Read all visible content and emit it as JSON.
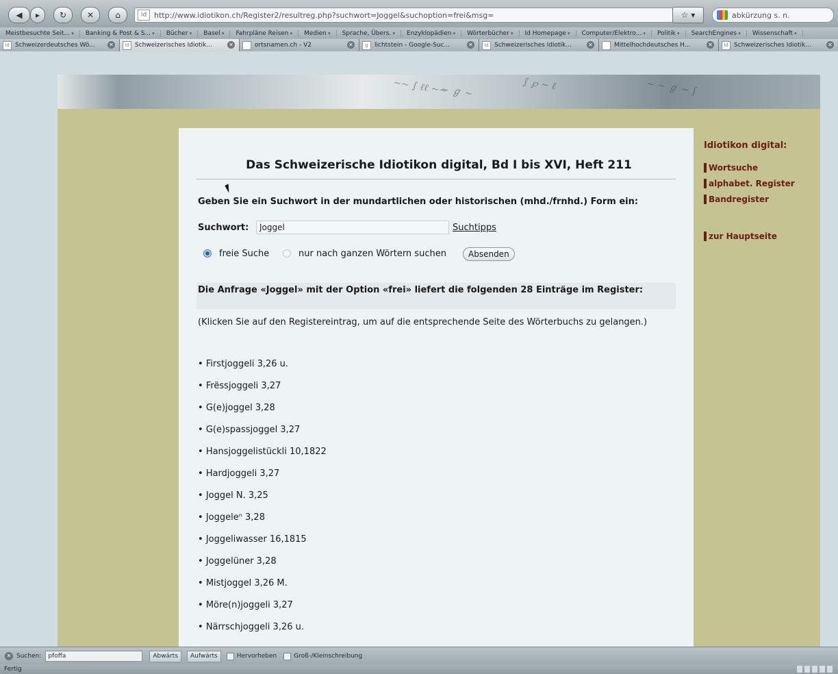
{
  "browser": {
    "back_icon": "back-arrow-icon",
    "url": "http://www.idiotikon.ch/Register2/resultreg.php?suchwort=Joggel&suchoption=frei&msg=",
    "url_favicon_text": "Id",
    "search_engine_text": "abkürzung s. n.",
    "bookmarks": [
      "Meistbesuchte Seit...",
      "Banking & Post & S...",
      "Bücher",
      "Basel",
      "Fahrpläne Reisen",
      "Medien",
      "Sprache, Übers.",
      "Enzyklopädien",
      "Wörterbücher",
      "Id Homepage",
      "Computer/Elektro...",
      "Politik",
      "SearchEngines",
      "Wissenschaft"
    ],
    "tabs": [
      {
        "label": "Schweizerdeutsches Wö...",
        "icon": "Id",
        "active": false
      },
      {
        "label": "Schweizerisches Idiotik...",
        "icon": "Id",
        "active": true
      },
      {
        "label": "ortsnamen.ch - V2",
        "icon": "",
        "active": false
      },
      {
        "label": "lichtstein - Google-Suc...",
        "icon": "g",
        "active": false
      },
      {
        "label": "Schweizerisches Idiotik...",
        "icon": "Id",
        "active": false
      },
      {
        "label": "Mittelhochdeutsches H...",
        "icon": "",
        "active": false
      },
      {
        "label": "Schweizerisches Idiotik...",
        "icon": "Id",
        "active": false
      }
    ]
  },
  "page": {
    "title": "Das Schweizerische Idiotikon digital, Bd I bis XVI, Heft 211",
    "instruction": "Geben Sie ein Suchwort in der mundartlichen oder historischen (mhd./frnhd.) Form ein:",
    "search_label": "Suchwort:",
    "search_value": "Joggel",
    "search_tips": "Suchtipps",
    "radio_free": "freie Suche",
    "radio_whole": "nur nach ganzen Wörtern suchen",
    "submit": "Absenden",
    "result_heading": "Die Anfrage «Joggel» mit der Option «frei» liefert die folgenden 28 Einträge im Register:",
    "result_note": "(Klicken Sie auf den Registereintrag, um auf die entsprechende Seite des Wörterbuchs zu gelangen.)",
    "entries": [
      "Firstjoggeli 3,26 u.",
      "Frëssjoggeli 3,27",
      "G(e)joggel 3,28",
      "G(e)spassjoggel 3,27",
      "Hansjoggelistückli 10,1822",
      "Hardjoggeli 3,27",
      "Joggel N. 3,25",
      "Joggeleⁿ 3,28",
      "Joggeliwasser 16,1815",
      "Joggelüner 3,28",
      "Mistjoggel 3,26 M.",
      "Möre(n)joggeli 3,27",
      "Närrschjoggeli 3,26 u."
    ]
  },
  "sidebar": {
    "title": "Idiotikon digital:",
    "links": [
      "Wortsuche",
      "alphabet. Register",
      "Bandregister"
    ],
    "home": "zur Hauptseite"
  },
  "findbar": {
    "label": "Suchen:",
    "value": "pfoffa",
    "down": "Abwärts",
    "up": "Aufwärts",
    "highlight": "Hervorheben",
    "case": "Groß-/Kleinschreibung"
  },
  "status": {
    "text": "Fertig"
  },
  "colors": {
    "sidebar_link": "#6b1c14",
    "frame": "#c5c391",
    "panel": "#eef3f5"
  }
}
